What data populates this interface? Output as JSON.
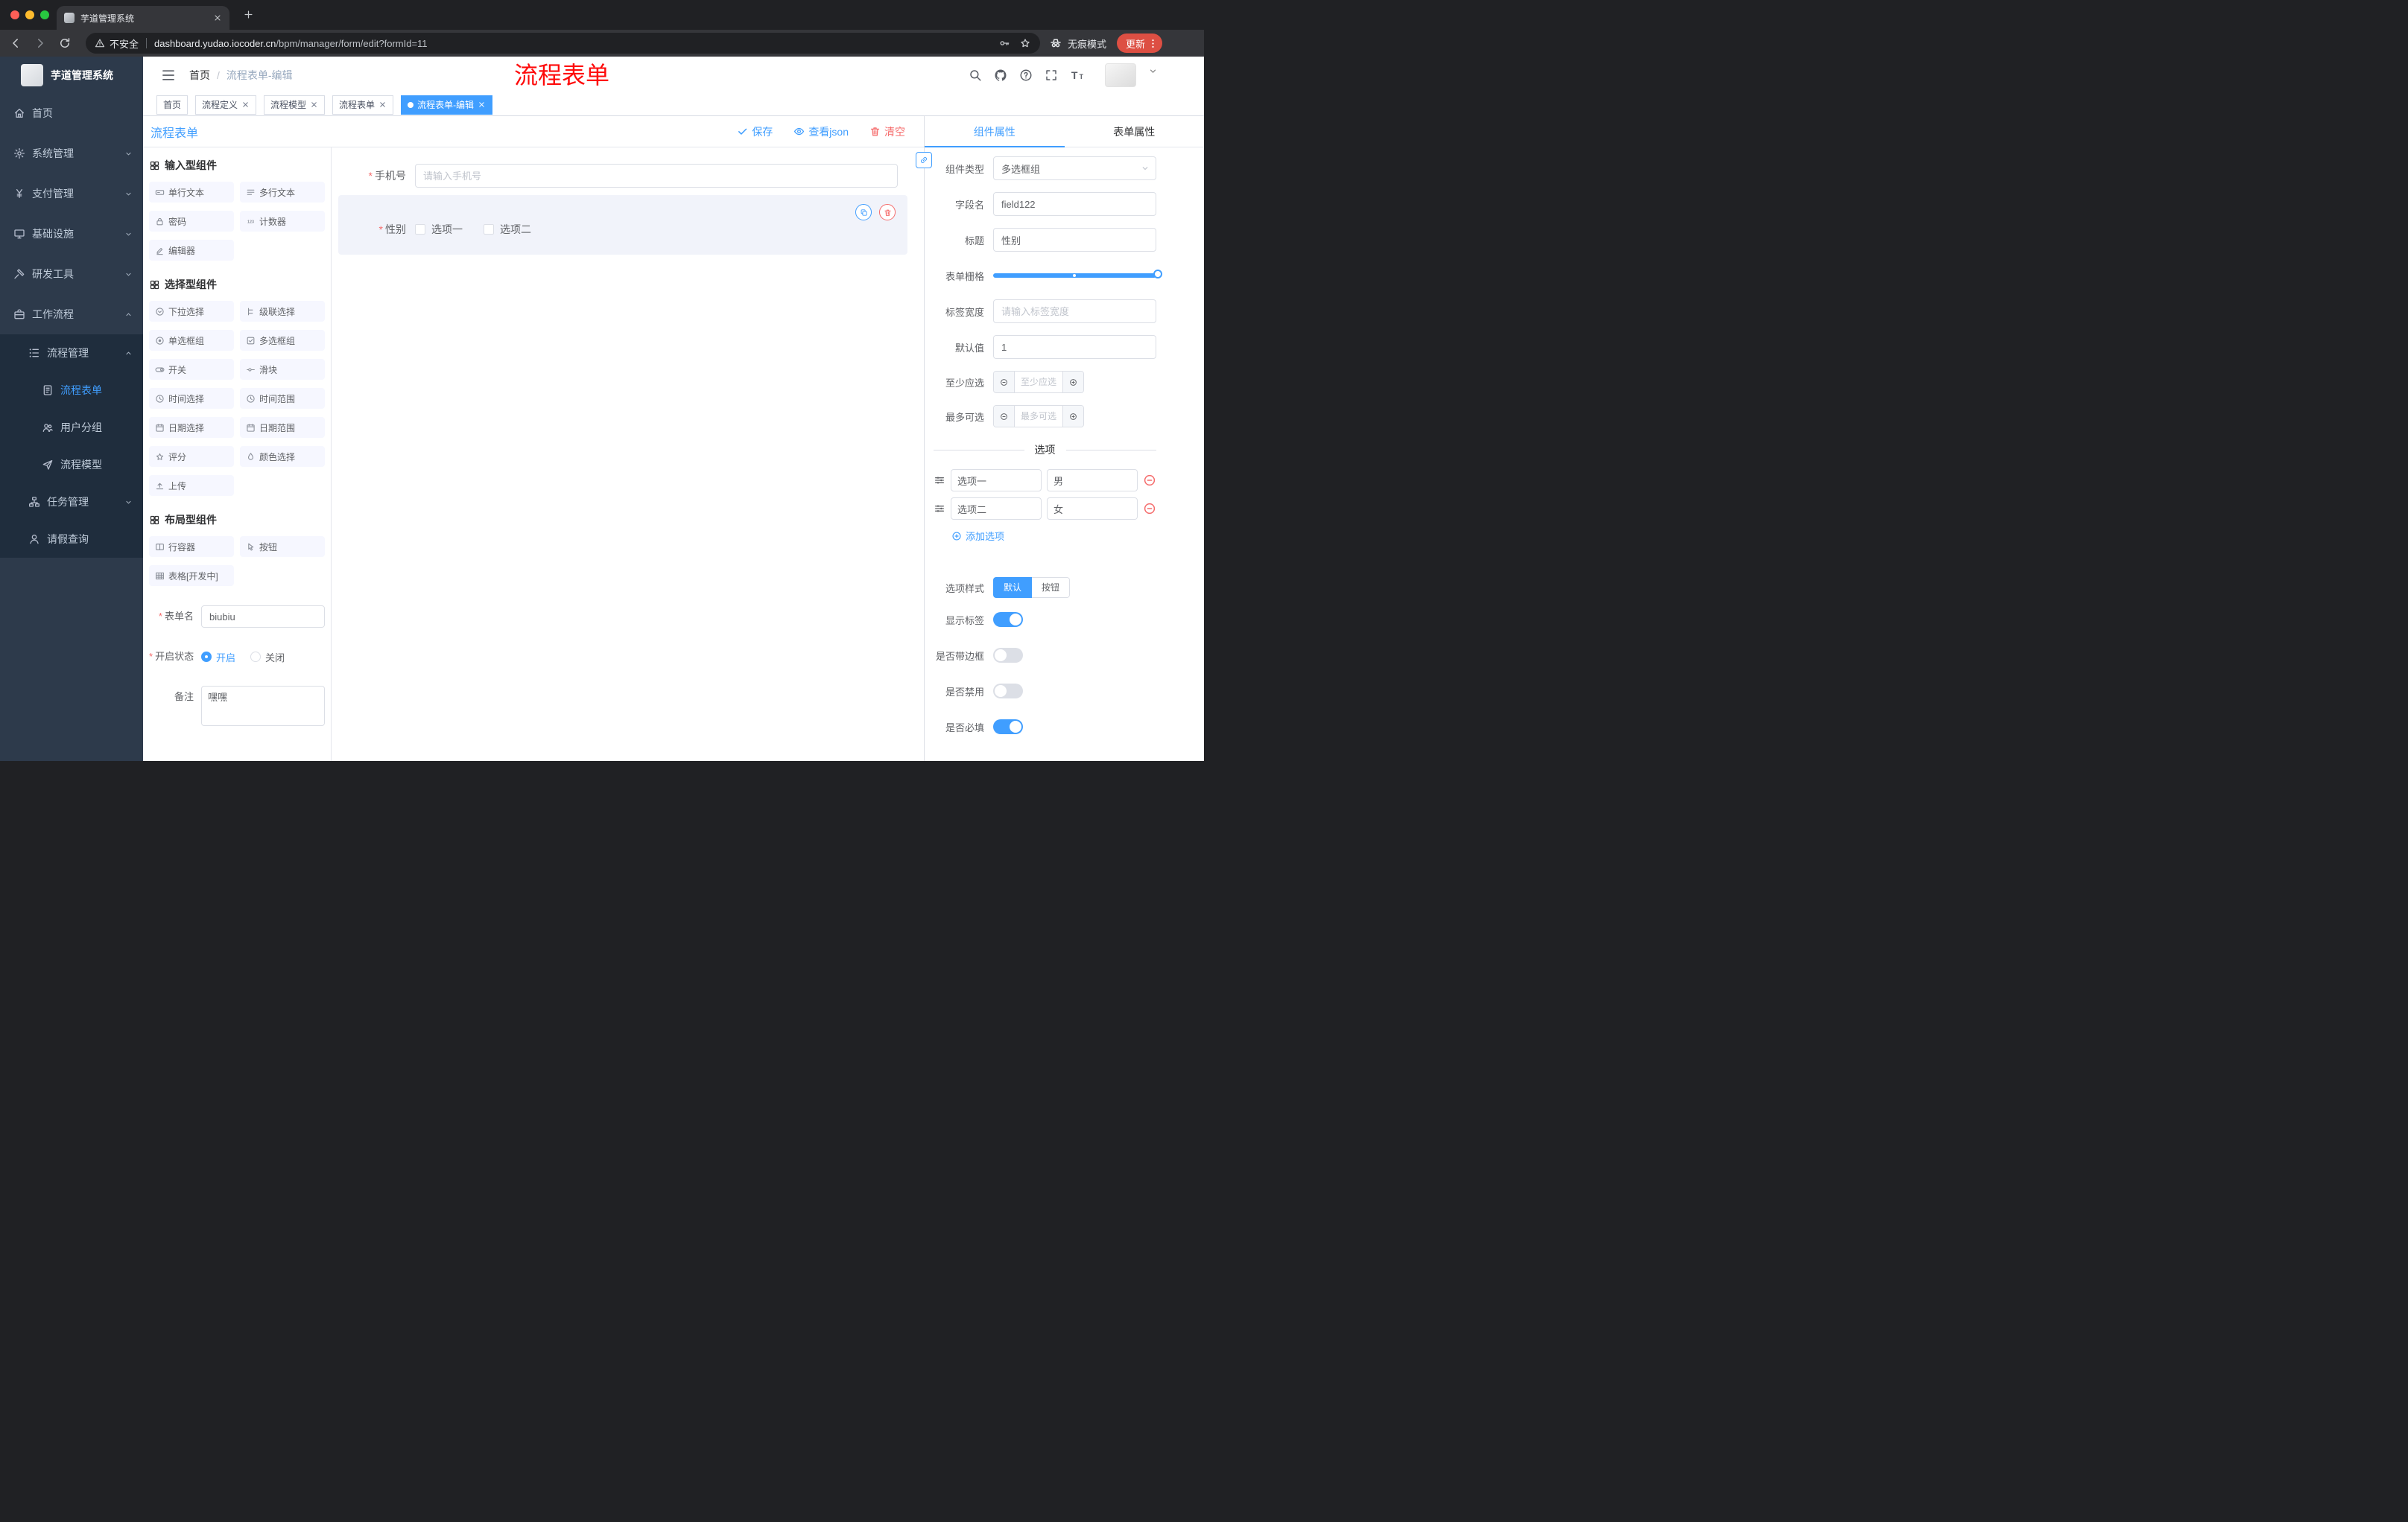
{
  "browser": {
    "tab_title": "芋道管理系统",
    "security_text": "不安全",
    "url_domain": "dashboard.yudao.iocoder.cn",
    "url_path": "/bpm/manager/form/edit?formId=11",
    "incognito_label": "无痕模式",
    "update_label": "更新"
  },
  "sidebar": {
    "logo_title": "芋道管理系统",
    "menu": [
      {
        "label": "首页"
      },
      {
        "label": "系统管理"
      },
      {
        "label": "支付管理"
      },
      {
        "label": "基础设施"
      },
      {
        "label": "研发工具"
      },
      {
        "label": "工作流程"
      },
      {
        "label": "流程管理"
      },
      {
        "label": "流程表单"
      },
      {
        "label": "用户分组"
      },
      {
        "label": "流程模型"
      },
      {
        "label": "任务管理"
      },
      {
        "label": "请假查询"
      }
    ]
  },
  "header": {
    "breadcrumb_home": "首页",
    "breadcrumb_sep": "/",
    "breadcrumb_current": "流程表单-编辑",
    "annotation": "流程表单"
  },
  "tags": [
    {
      "label": "首页"
    },
    {
      "label": "流程定义"
    },
    {
      "label": "流程模型"
    },
    {
      "label": "流程表单"
    },
    {
      "label": "流程表单-编辑"
    }
  ],
  "designer": {
    "title": "流程表单",
    "toolbar": {
      "save": "保存",
      "view_json": "查看json",
      "clear": "清空"
    },
    "palette": {
      "sections": [
        {
          "title": "输入型组件",
          "items": [
            "单行文本",
            "多行文本",
            "密码",
            "计数器",
            "编辑器"
          ]
        },
        {
          "title": "选择型组件",
          "items": [
            "下拉选择",
            "级联选择",
            "单选框组",
            "多选框组",
            "开关",
            "滑块",
            "时间选择",
            "时间范围",
            "日期选择",
            "日期范围",
            "评分",
            "颜色选择",
            "上传"
          ]
        },
        {
          "title": "布局型组件",
          "items": [
            "行容器",
            "按钮",
            "表格[开发中]"
          ]
        }
      ]
    },
    "meta": {
      "name_label": "表单名",
      "name_value": "biubiu",
      "status_label": "开启状态",
      "status_on": "开启",
      "status_off": "关闭",
      "remark_label": "备注",
      "remark_value": "嘿嘿"
    },
    "canvas": {
      "phone_label": "手机号",
      "phone_placeholder": "请输入手机号",
      "gender_label": "性别",
      "gender_option1": "选项一",
      "gender_option2": "选项二"
    }
  },
  "props": {
    "tab_component": "组件属性",
    "tab_form": "表单属性",
    "component_type_label": "组件类型",
    "component_type_value": "多选框组",
    "field_name_label": "字段名",
    "field_name_value": "field122",
    "title_label": "标题",
    "title_value": "性别",
    "grid_label": "表单栅格",
    "label_width_label": "标签宽度",
    "label_width_placeholder": "请输入标签宽度",
    "default_label": "默认值",
    "default_value": "1",
    "min_label": "至少应选",
    "min_placeholder": "至少应选",
    "max_label": "最多可选",
    "max_placeholder": "最多可选",
    "options_title": "选项",
    "options": [
      {
        "label": "选项一",
        "value": "男"
      },
      {
        "label": "选项二",
        "value": "女"
      }
    ],
    "add_option_label": "添加选项",
    "option_style_label": "选项样式",
    "option_style_default": "默认",
    "option_style_button": "按钮",
    "show_label_label": "显示标签",
    "border_label": "是否带边框",
    "disabled_label": "是否禁用",
    "required_label": "是否必填"
  },
  "colors": {
    "primary": "#409eff",
    "danger": "#f56c6c",
    "annotation_red": "#fe0b0b",
    "update_pill": "#dd4f43",
    "sidebar_bg": "#2d3a4b",
    "sidebar_submenu_bg": "#1f2d3d"
  },
  "icons": {
    "browser": [
      "back-icon",
      "forward-icon",
      "reload-icon",
      "warning-icon",
      "key-icon",
      "bookmark-star-icon",
      "incognito-icon",
      "more-vertical-icon",
      "new-tab-icon",
      "tab-close-icon"
    ],
    "app_header": [
      "fold-icon",
      "search-icon",
      "github-icon",
      "question-icon",
      "fullscreen-icon",
      "font-size-icon",
      "caret-down-icon"
    ],
    "designer": [
      "check-icon",
      "eye-icon",
      "trash-icon",
      "copy-icon",
      "delete-icon"
    ],
    "props": [
      "link-icon",
      "drag-handle-icon",
      "remove-option-icon",
      "add-option-icon"
    ]
  }
}
